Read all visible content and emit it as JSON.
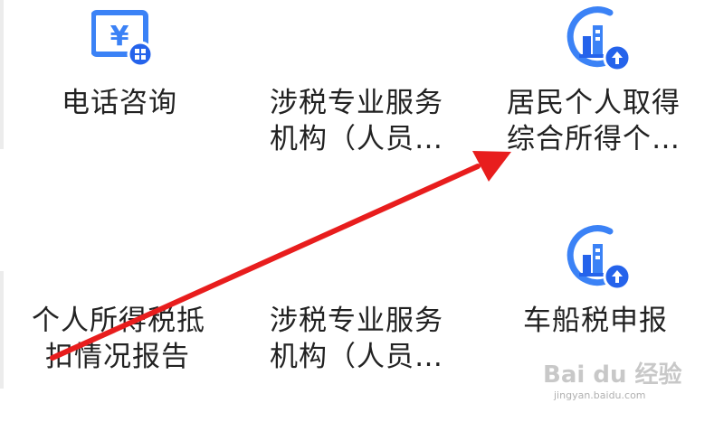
{
  "colors": {
    "icon_blue": "#3b82f6",
    "icon_dark_blue": "#2563eb",
    "text": "#222222",
    "arrow": "#e81d1d"
  },
  "grid": {
    "row1": [
      {
        "label_lines": [
          "电话咨询"
        ],
        "icon": "yuan-screen-icon"
      },
      {
        "label_lines": [
          "涉税专业服务",
          "机构（人员…"
        ],
        "icon": null
      },
      {
        "label_lines": [
          "居民个人取得",
          "综合所得个…"
        ],
        "icon": "building-upload-icon"
      }
    ],
    "row2": [
      {
        "label_lines": [
          "个人所得税抵",
          "扣情况报告"
        ],
        "icon": null
      },
      {
        "label_lines": [
          "涉税专业服务",
          "机构（人员…"
        ],
        "icon": null
      },
      {
        "label_lines": [
          "车船税申报"
        ],
        "icon": "building-upload-icon"
      }
    ]
  },
  "watermark": {
    "brand": "Bai du 经验",
    "url": "jingyan.baidu.com"
  }
}
